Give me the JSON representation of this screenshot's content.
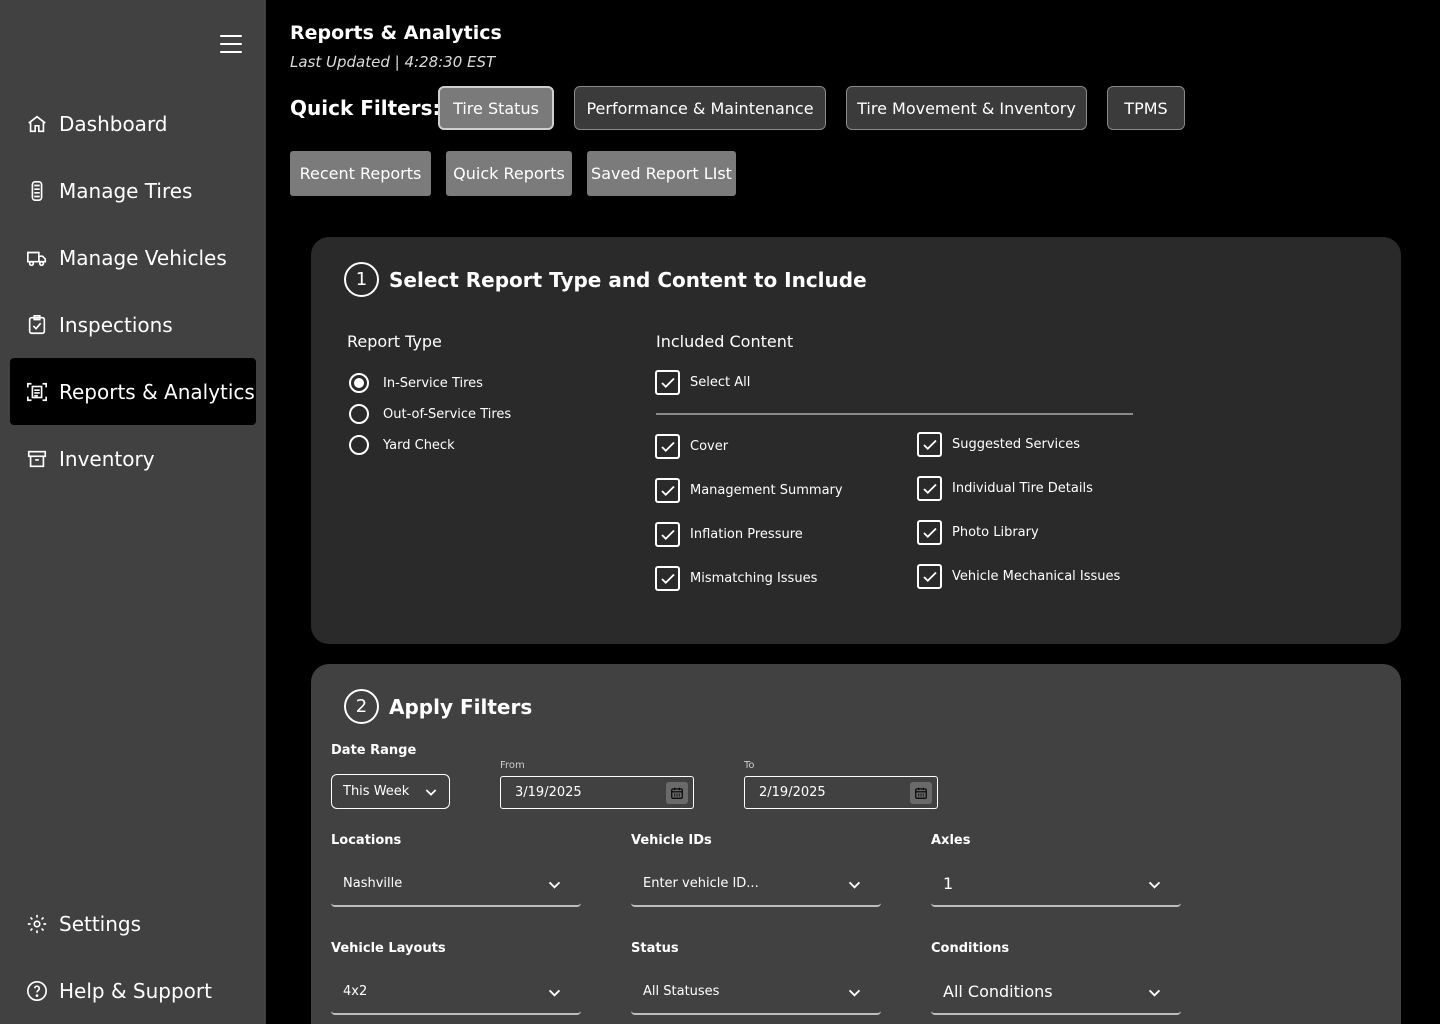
{
  "sidebar": {
    "menu_icon": "hamburger-icon",
    "items": [
      {
        "label": "Dashboard",
        "icon": "home-icon",
        "active": false
      },
      {
        "label": "Manage Tires",
        "icon": "tire-icon",
        "active": false
      },
      {
        "label": "Manage Vehicles",
        "icon": "truck-icon",
        "active": false
      },
      {
        "label": "Inspections",
        "icon": "clipboard-check-icon",
        "active": false
      },
      {
        "label": "Reports & Analytics",
        "icon": "report-scan-icon",
        "active": true
      },
      {
        "label": "Inventory",
        "icon": "archive-box-icon",
        "active": false
      }
    ],
    "bottom_items": [
      {
        "label": "Settings",
        "icon": "gear-icon"
      },
      {
        "label": "Help & Support",
        "icon": "help-circle-icon"
      }
    ]
  },
  "header": {
    "title": "Reports & Analytics",
    "last_updated": "Last Updated | 4:28:30 EST"
  },
  "quick_filters": {
    "label": "Quick Filters:",
    "pills": [
      "Tire Status",
      "Performance & Maintenance",
      "Tire Movement & Inventory",
      "TPMS"
    ],
    "active": "Tire Status"
  },
  "report_buttons": [
    "Recent Reports",
    "Quick Reports",
    "Saved Report LIst"
  ],
  "section1": {
    "number": "1",
    "title": "Select Report Type and Content to Include",
    "report_type": {
      "label": "Report Type",
      "options": [
        "In-Service Tires",
        "Out-of-Service Tires",
        "Yard Check"
      ],
      "selected": "In-Service Tires"
    },
    "included_content": {
      "label": "Included Content",
      "select_all": "Select All",
      "left": [
        "Cover",
        "Management Summary",
        "Inflation Pressure",
        "Mismatching Issues"
      ],
      "right": [
        "Suggested Services",
        "Individual Tire Details",
        "Photo Library",
        "Vehicle Mechanical Issues"
      ],
      "all_checked": true
    }
  },
  "section2": {
    "number": "2",
    "title": "Apply Filters",
    "date_range": {
      "label": "Date Range",
      "value": "This Week"
    },
    "from": {
      "label": "From",
      "value": "3/19/2025"
    },
    "to": {
      "label": "To",
      "value": "2/19/2025"
    },
    "locations": {
      "label": "Locations",
      "value": "Nashville"
    },
    "vehicle_ids": {
      "label": "Vehicle IDs",
      "placeholder": "Enter vehicle ID..."
    },
    "axles": {
      "label": "Axles",
      "value": "1"
    },
    "vehicle_layouts": {
      "label": "Vehicle Layouts",
      "value": "4x2"
    },
    "status": {
      "label": "Status",
      "value": "All Statuses"
    },
    "conditions": {
      "label": "Conditions",
      "value": "All Conditions"
    }
  },
  "colors": {
    "sidebar_bg": "#414141",
    "page_bg": "#000000",
    "panel1_bg": "#2a2a2a",
    "panel2_bg": "#414141",
    "active_pill": "#7a7a7a"
  }
}
